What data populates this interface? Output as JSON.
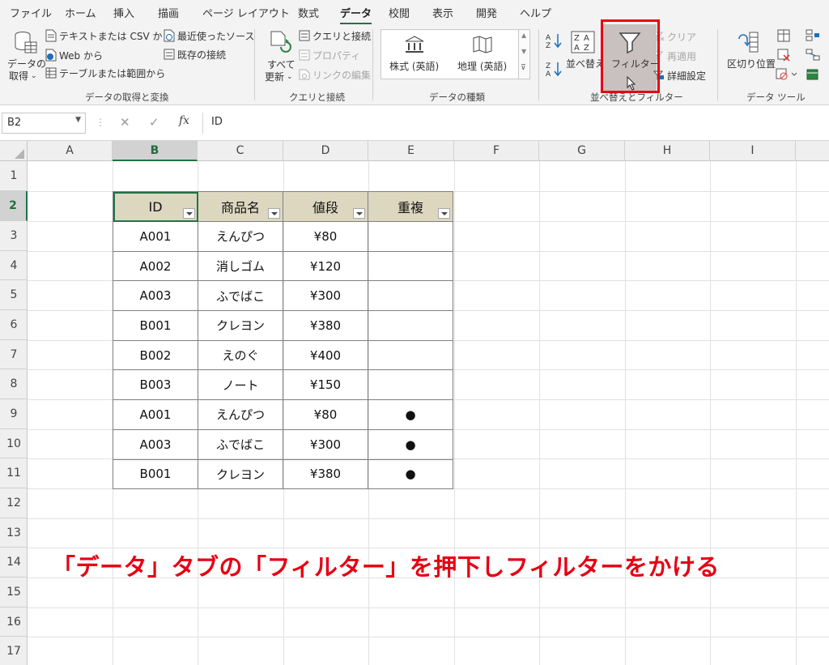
{
  "menu": {
    "tabs": [
      "ファイル",
      "ホーム",
      "挿入",
      "描画",
      "ページ レイアウト",
      "数式",
      "データ",
      "校閲",
      "表示",
      "開発",
      "ヘルプ"
    ],
    "active": "データ"
  },
  "ribbon": {
    "get_data": {
      "big_label_1": "データの",
      "big_label_2": "取得",
      "text_csv": "テキストまたは CSV から",
      "web": "Web から",
      "table_range": "テーブルまたは範囲から",
      "recent": "最近使ったソース",
      "existing": "既存の接続",
      "group": "データの取得と変換"
    },
    "queries": {
      "refresh_1": "すべて",
      "refresh_2": "更新",
      "queries_conn": "クエリと接続",
      "properties": "プロパティ",
      "edit_links": "リンクの編集",
      "group": "クエリと接続"
    },
    "data_types": {
      "stocks": "株式 (英語)",
      "geography": "地理 (英語)",
      "group": "データの種類"
    },
    "sort_filter": {
      "sort": "並べ替え",
      "filter": "フィルター",
      "clear": "クリア",
      "reapply": "再適用",
      "advanced": "詳細設定",
      "group": "並べ替えとフィルター"
    },
    "tools": {
      "text_to_columns": "区切り位置",
      "group": "データ ツール"
    }
  },
  "formula_bar": {
    "name_box": "B2",
    "fx": "fx",
    "value": "ID"
  },
  "grid": {
    "columns": [
      "A",
      "B",
      "C",
      "D",
      "E",
      "F",
      "G",
      "H",
      "I"
    ],
    "rows": [
      "1",
      "2",
      "3",
      "4",
      "5",
      "6",
      "7",
      "8",
      "9",
      "10",
      "11",
      "12",
      "13",
      "14",
      "15",
      "16",
      "17"
    ],
    "selected_col": "B",
    "selected_row": "2"
  },
  "table": {
    "headers": [
      "ID",
      "商品名",
      "値段",
      "重複"
    ],
    "rows": [
      [
        "A001",
        "えんぴつ",
        "¥80",
        ""
      ],
      [
        "A002",
        "消しゴム",
        "¥120",
        ""
      ],
      [
        "A003",
        "ふでばこ",
        "¥300",
        ""
      ],
      [
        "B001",
        "クレヨン",
        "¥380",
        ""
      ],
      [
        "B002",
        "えのぐ",
        "¥400",
        ""
      ],
      [
        "B003",
        "ノート",
        "¥150",
        ""
      ],
      [
        "A001",
        "えんぴつ",
        "¥80",
        "●"
      ],
      [
        "A003",
        "ふでばこ",
        "¥300",
        "●"
      ],
      [
        "B001",
        "クレヨン",
        "¥380",
        "●"
      ]
    ]
  },
  "annotation": {
    "text": "「データ」タブの「フィルター」を押下しフィルターをかける",
    "color": "#e60012"
  }
}
